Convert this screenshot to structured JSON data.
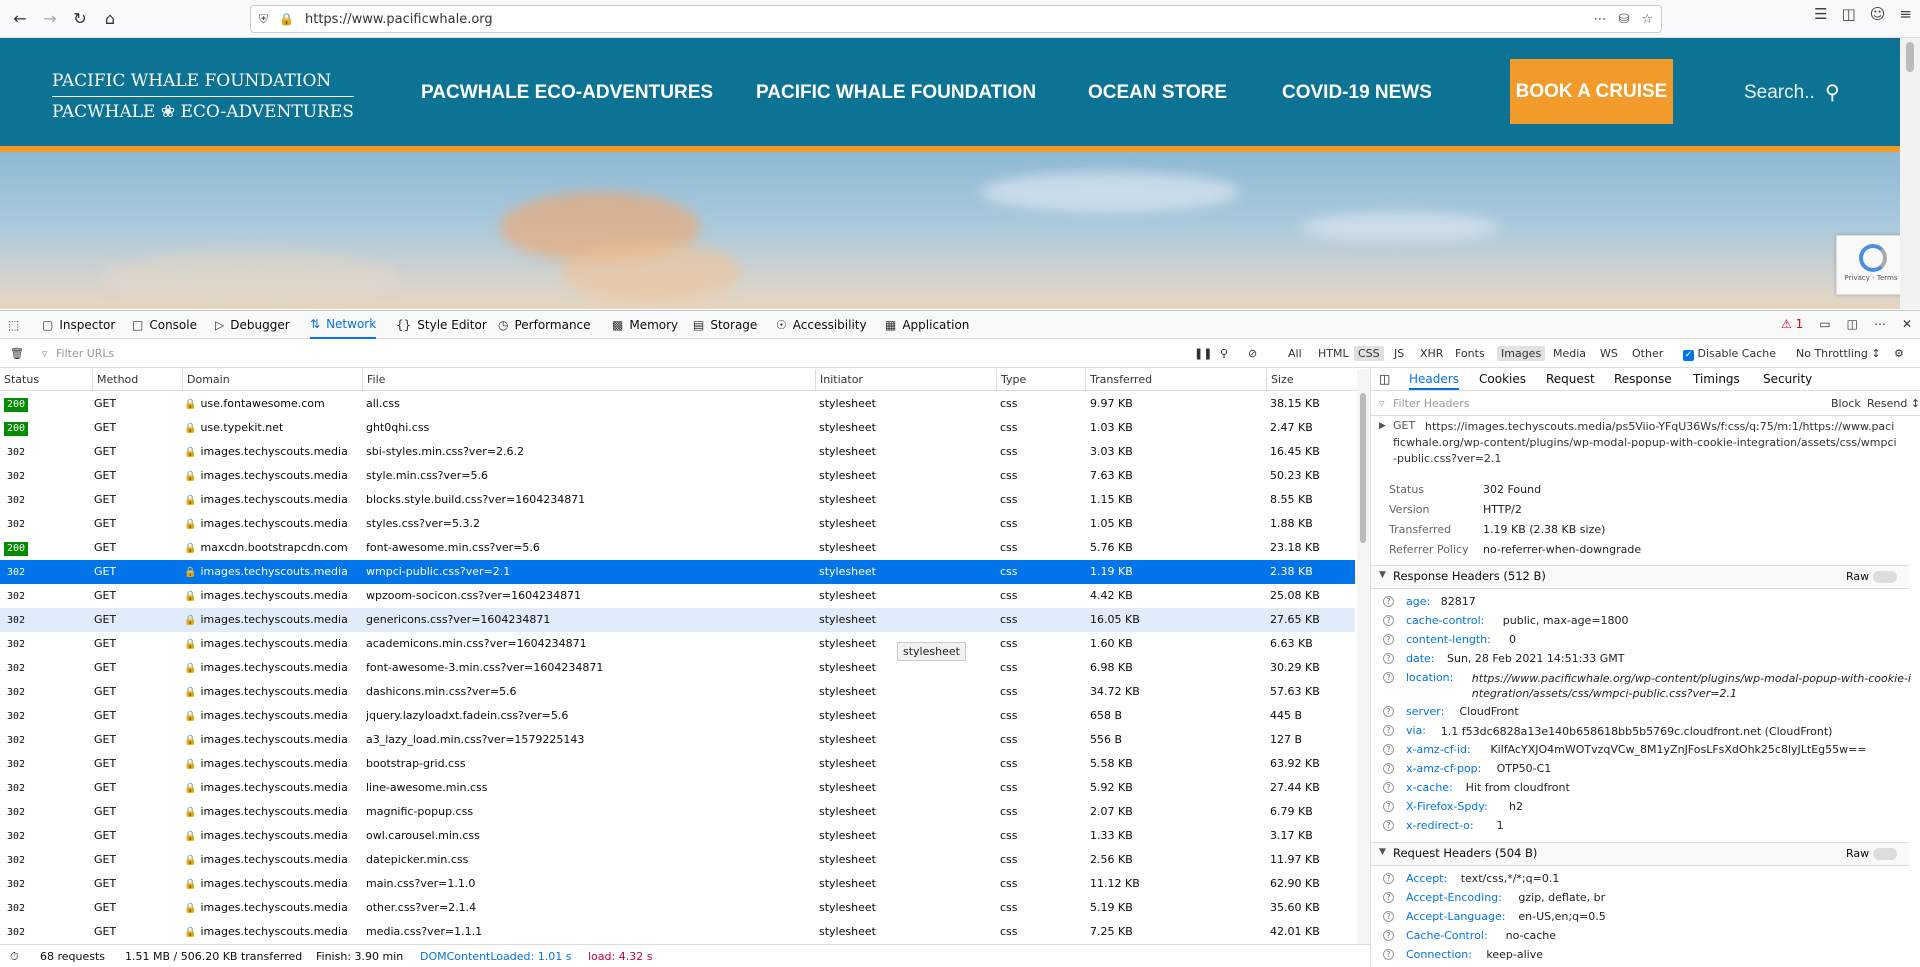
{
  "browser": {
    "url": "https://www.pacificwhale.org"
  },
  "site": {
    "logo_line1": "PACIFIC WHALE FOUNDATION",
    "logo_line2": "PACWHALE ❀ ECO-ADVENTURES",
    "nav": [
      "PACWHALE ECO-ADVENTURES",
      "PACIFIC WHALE FOUNDATION",
      "OCEAN STORE",
      "COVID-19 NEWS"
    ],
    "book": "BOOK A CRUISE",
    "search_placeholder": "Search..",
    "recaptcha": "Privacy - Terms",
    "colors": {
      "header": "#0d7394",
      "accent": "#f29b2a"
    }
  },
  "devtools": {
    "tabs": [
      "Inspector",
      "Console",
      "Debugger",
      "Network",
      "Style Editor",
      "Performance",
      "Memory",
      "Storage",
      "Accessibility",
      "Application"
    ],
    "active_tab": "Network",
    "error_count": "1",
    "filter_placeholder": "Filter URLs",
    "types": [
      "All",
      "HTML",
      "CSS",
      "JS",
      "XHR",
      "Fonts",
      "Images",
      "Media",
      "WS",
      "Other"
    ],
    "disable_cache": "Disable Cache",
    "throttling": "No Throttling ↕",
    "columns": [
      "Status",
      "Method",
      "Domain",
      "File",
      "Initiator",
      "Type",
      "Transferred",
      "Size"
    ],
    "rows": [
      {
        "status": "200",
        "method": "GET",
        "domain": "use.fontawesome.com",
        "file": "all.css",
        "initiator": "stylesheet",
        "type": "css",
        "transferred": "9.97 KB",
        "size": "38.15 KB"
      },
      {
        "status": "200",
        "method": "GET",
        "domain": "use.typekit.net",
        "file": "ght0qhi.css",
        "initiator": "stylesheet",
        "type": "css",
        "transferred": "1.03 KB",
        "size": "2.47 KB"
      },
      {
        "status": "302",
        "method": "GET",
        "domain": "images.techyscouts.media",
        "file": "sbi-styles.min.css?ver=2.6.2",
        "initiator": "stylesheet",
        "type": "css",
        "transferred": "3.03 KB",
        "size": "16.45 KB"
      },
      {
        "status": "302",
        "method": "GET",
        "domain": "images.techyscouts.media",
        "file": "style.min.css?ver=5.6",
        "initiator": "stylesheet",
        "type": "css",
        "transferred": "7.63 KB",
        "size": "50.23 KB"
      },
      {
        "status": "302",
        "method": "GET",
        "domain": "images.techyscouts.media",
        "file": "blocks.style.build.css?ver=1604234871",
        "initiator": "stylesheet",
        "type": "css",
        "transferred": "1.15 KB",
        "size": "8.55 KB"
      },
      {
        "status": "302",
        "method": "GET",
        "domain": "images.techyscouts.media",
        "file": "styles.css?ver=5.3.2",
        "initiator": "stylesheet",
        "type": "css",
        "transferred": "1.05 KB",
        "size": "1.88 KB"
      },
      {
        "status": "200",
        "method": "GET",
        "domain": "maxcdn.bootstrapcdn.com",
        "file": "font-awesome.min.css?ver=5.6",
        "initiator": "stylesheet",
        "type": "css",
        "transferred": "5.76 KB",
        "size": "23.18 KB"
      },
      {
        "status": "302",
        "method": "GET",
        "domain": "images.techyscouts.media",
        "file": "wmpci-public.css?ver=2.1",
        "initiator": "stylesheet",
        "type": "css",
        "transferred": "1.19 KB",
        "size": "2.38 KB"
      },
      {
        "status": "302",
        "method": "GET",
        "domain": "images.techyscouts.media",
        "file": "wpzoom-socicon.css?ver=1604234871",
        "initiator": "stylesheet",
        "type": "css",
        "transferred": "4.42 KB",
        "size": "25.08 KB"
      },
      {
        "status": "302",
        "method": "GET",
        "domain": "images.techyscouts.media",
        "file": "genericons.css?ver=1604234871",
        "initiator": "stylesheet",
        "type": "css",
        "transferred": "16.05 KB",
        "size": "27.65 KB"
      },
      {
        "status": "302",
        "method": "GET",
        "domain": "images.techyscouts.media",
        "file": "academicons.min.css?ver=1604234871",
        "initiator": "stylesheet",
        "type": "css",
        "transferred": "1.60 KB",
        "size": "6.63 KB"
      },
      {
        "status": "302",
        "method": "GET",
        "domain": "images.techyscouts.media",
        "file": "font-awesome-3.min.css?ver=1604234871",
        "initiator": "stylesheet",
        "type": "css",
        "transferred": "6.98 KB",
        "size": "30.29 KB"
      },
      {
        "status": "302",
        "method": "GET",
        "domain": "images.techyscouts.media",
        "file": "dashicons.min.css?ver=5.6",
        "initiator": "stylesheet",
        "type": "css",
        "transferred": "34.72 KB",
        "size": "57.63 KB"
      },
      {
        "status": "302",
        "method": "GET",
        "domain": "images.techyscouts.media",
        "file": "jquery.lazyloadxt.fadein.css?ver=5.6",
        "initiator": "stylesheet",
        "type": "css",
        "transferred": "658 B",
        "size": "445 B"
      },
      {
        "status": "302",
        "method": "GET",
        "domain": "images.techyscouts.media",
        "file": "a3_lazy_load.min.css?ver=1579225143",
        "initiator": "stylesheet",
        "type": "css",
        "transferred": "556 B",
        "size": "127 B"
      },
      {
        "status": "302",
        "method": "GET",
        "domain": "images.techyscouts.media",
        "file": "bootstrap-grid.css",
        "initiator": "stylesheet",
        "type": "css",
        "transferred": "5.58 KB",
        "size": "63.92 KB"
      },
      {
        "status": "302",
        "method": "GET",
        "domain": "images.techyscouts.media",
        "file": "line-awesome.min.css",
        "initiator": "stylesheet",
        "type": "css",
        "transferred": "5.92 KB",
        "size": "27.44 KB"
      },
      {
        "status": "302",
        "method": "GET",
        "domain": "images.techyscouts.media",
        "file": "magnific-popup.css",
        "initiator": "stylesheet",
        "type": "css",
        "transferred": "2.07 KB",
        "size": "6.79 KB"
      },
      {
        "status": "302",
        "method": "GET",
        "domain": "images.techyscouts.media",
        "file": "owl.carousel.min.css",
        "initiator": "stylesheet",
        "type": "css",
        "transferred": "1.33 KB",
        "size": "3.17 KB"
      },
      {
        "status": "302",
        "method": "GET",
        "domain": "images.techyscouts.media",
        "file": "datepicker.min.css",
        "initiator": "stylesheet",
        "type": "css",
        "transferred": "2.56 KB",
        "size": "11.97 KB"
      },
      {
        "status": "302",
        "method": "GET",
        "domain": "images.techyscouts.media",
        "file": "main.css?ver=1.1.0",
        "initiator": "stylesheet",
        "type": "css",
        "transferred": "11.12 KB",
        "size": "62.90 KB"
      },
      {
        "status": "302",
        "method": "GET",
        "domain": "images.techyscouts.media",
        "file": "other.css?ver=2.1.4",
        "initiator": "stylesheet",
        "type": "css",
        "transferred": "5.19 KB",
        "size": "35.60 KB"
      },
      {
        "status": "302",
        "method": "GET",
        "domain": "images.techyscouts.media",
        "file": "media.css?ver=1.1.1",
        "initiator": "stylesheet",
        "type": "css",
        "transferred": "7.25 KB",
        "size": "42.01 KB"
      }
    ],
    "selected_row": 7,
    "hovered_row": 9,
    "tooltip": "stylesheet",
    "status_bar": {
      "requests": "68 requests",
      "transferred": "1.51 MB / 506.20 KB transferred",
      "finish": "Finish: 3.90 min",
      "dcl": "DOMContentLoaded: 1.01 s",
      "load": "load: 4.32 s"
    },
    "sidebar": {
      "tabs": [
        "Headers",
        "Cookies",
        "Request",
        "Response",
        "Timings",
        "Security"
      ],
      "filter_placeholder": "Filter Headers",
      "block": "Block",
      "resend": "Resend ↕",
      "request_line": "GET",
      "request_url": "https://images.techyscouts.media/ps5Viio-YFqU36Ws/f:css/q:75/m:1/https://www.pacificwhale.org/wp-content/plugins/wp-modal-popup-with-cookie-integration/assets/css/wmpci-public.css?ver=2.1",
      "summary": [
        {
          "k": "Status",
          "v": "302 Found"
        },
        {
          "k": "Version",
          "v": "HTTP/2"
        },
        {
          "k": "Transferred",
          "v": "1.19 KB (2.38 KB size)"
        },
        {
          "k": "Referrer Policy",
          "v": "no-referrer-when-downgrade"
        }
      ],
      "response_title": "Response Headers (512 B)",
      "raw": "Raw",
      "response_headers": [
        {
          "k": "age:",
          "v": "82817"
        },
        {
          "k": "cache-control:",
          "v": "public, max-age=1800"
        },
        {
          "k": "content-length:",
          "v": "0"
        },
        {
          "k": "date:",
          "v": "Sun, 28 Feb 2021 14:51:33 GMT"
        },
        {
          "k": "location:",
          "v": "https://www.pacificwhale.org/wp-content/plugins/wp-modal-popup-with-cookie-integration/assets/css/wmpci-public.css?ver=2.1"
        },
        {
          "k": "server:",
          "v": "CloudFront"
        },
        {
          "k": "via:",
          "v": "1.1 f53dc6828a13e140b658618bb5b5769c.cloudfront.net (CloudFront)"
        },
        {
          "k": "x-amz-cf-id:",
          "v": "KilfAcYXJO4mWOTvzqVCw_8M1yZnJFosLFsXdOhk25c8lyJLtEg55w=="
        },
        {
          "k": "x-amz-cf-pop:",
          "v": "OTP50-C1"
        },
        {
          "k": "x-cache:",
          "v": "Hit from cloudfront"
        },
        {
          "k": "X-Firefox-Spdy:",
          "v": "h2"
        },
        {
          "k": "x-redirect-o:",
          "v": "1"
        }
      ],
      "request_title": "Request Headers (504 B)",
      "request_headers": [
        {
          "k": "Accept:",
          "v": "text/css,*/*;q=0.1"
        },
        {
          "k": "Accept-Encoding:",
          "v": "gzip, deflate, br"
        },
        {
          "k": "Accept-Language:",
          "v": "en-US,en;q=0.5"
        },
        {
          "k": "Cache-Control:",
          "v": "no-cache"
        },
        {
          "k": "Connection:",
          "v": "keep-alive"
        }
      ]
    }
  }
}
